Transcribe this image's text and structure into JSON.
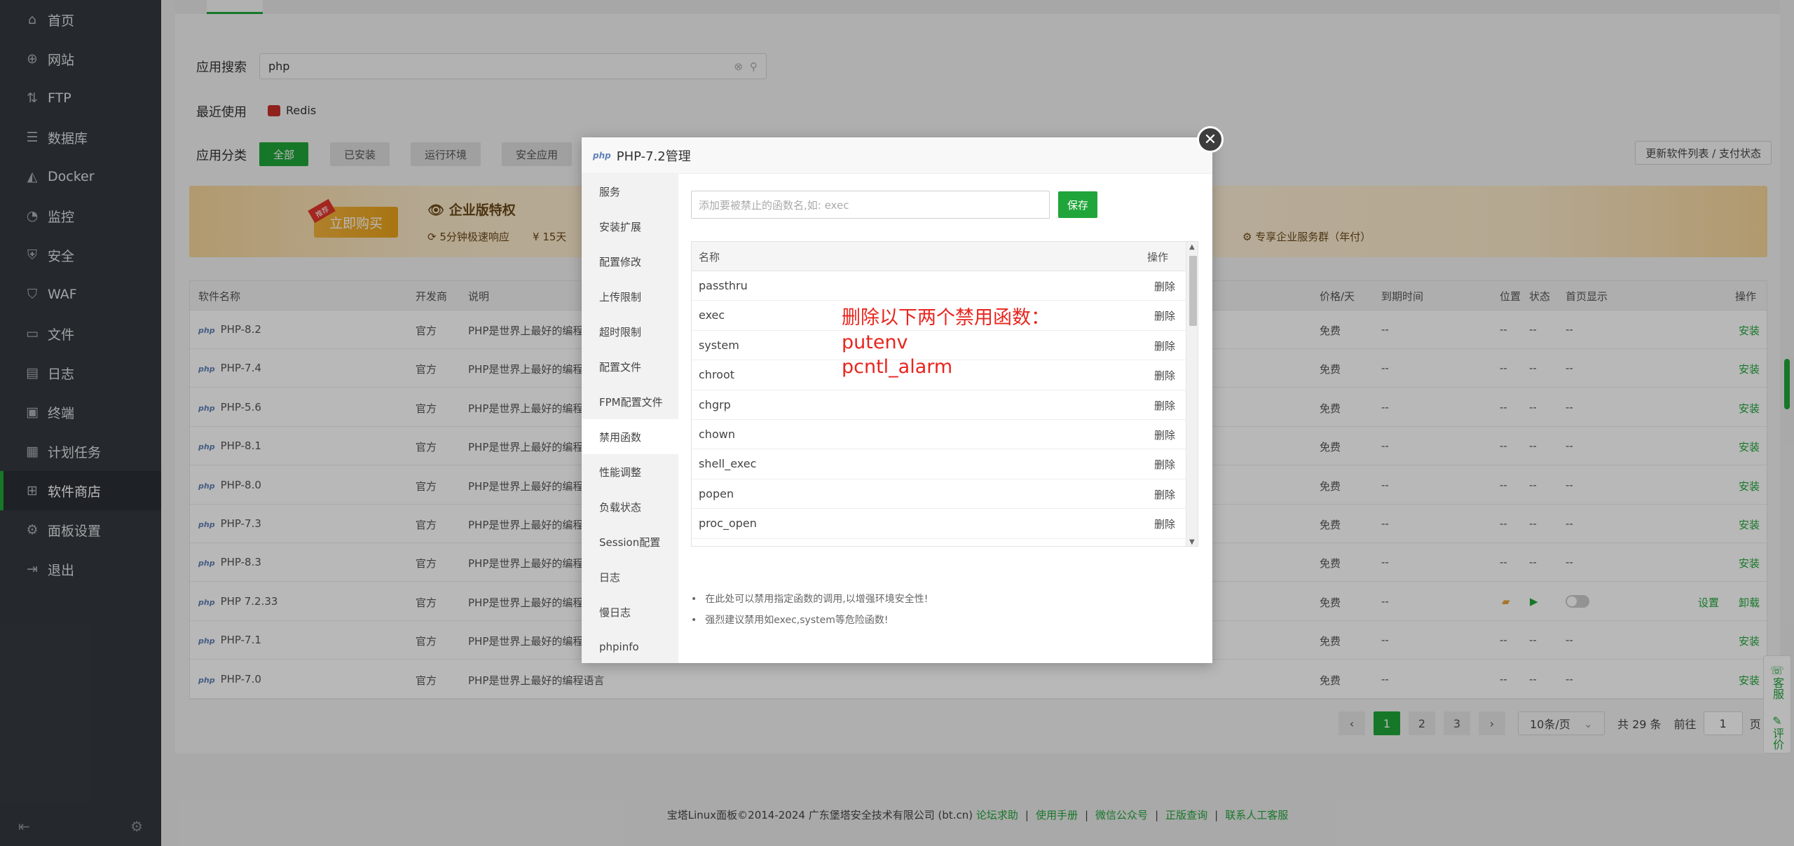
{
  "sidebar": {
    "items": [
      {
        "label": "首页",
        "icon": "home-icon"
      },
      {
        "label": "网站",
        "icon": "globe-icon"
      },
      {
        "label": "FTP",
        "icon": "ftp-icon"
      },
      {
        "label": "数据库",
        "icon": "database-icon"
      },
      {
        "label": "Docker",
        "icon": "docker-icon"
      },
      {
        "label": "监控",
        "icon": "monitor-icon"
      },
      {
        "label": "安全",
        "icon": "shield-icon"
      },
      {
        "label": "WAF",
        "icon": "waf-icon"
      },
      {
        "label": "文件",
        "icon": "folder-icon"
      },
      {
        "label": "日志",
        "icon": "log-icon"
      },
      {
        "label": "终端",
        "icon": "terminal-icon"
      },
      {
        "label": "计划任务",
        "icon": "calendar-icon"
      },
      {
        "label": "软件商店",
        "icon": "grid-icon"
      },
      {
        "label": "面板设置",
        "icon": "settings-icon"
      },
      {
        "label": "退出",
        "icon": "logout-icon"
      }
    ],
    "active_index": 12
  },
  "search": {
    "label": "应用搜索",
    "value": "php"
  },
  "recent": {
    "label": "最近使用",
    "item": "Redis"
  },
  "category": {
    "label": "应用分类",
    "buttons": [
      "全部",
      "已安装",
      "运行环境",
      "安全应用"
    ],
    "update_button": "更新软件列表 / 支付状态"
  },
  "banner": {
    "buy_button": "立即购买",
    "buy_tag": "推荐",
    "title": "企业版特权",
    "sub1": "5分钟极速响应",
    "sub2": "15天",
    "right_text": "专享企业服务群（年付）"
  },
  "table": {
    "headers": [
      "软件名称",
      "开发商",
      "说明",
      "价格/天",
      "到期时间",
      "位置",
      "状态",
      "首页显示",
      "操作"
    ],
    "rows": [
      {
        "name": "PHP-8.2",
        "dev": "官方",
        "desc": "PHP是世界上最好的编程语言",
        "price": "免费",
        "expire": "--",
        "loc": "--",
        "status": "--",
        "home": "--",
        "ops": "安装"
      },
      {
        "name": "PHP-7.4",
        "dev": "官方",
        "desc": "PHP是世界上最好的编程语言",
        "price": "免费",
        "expire": "--",
        "loc": "--",
        "status": "--",
        "home": "--",
        "ops": "安装"
      },
      {
        "name": "PHP-5.6",
        "dev": "官方",
        "desc": "PHP是世界上最好的编程语言",
        "price": "免费",
        "expire": "--",
        "loc": "--",
        "status": "--",
        "home": "--",
        "ops": "安装"
      },
      {
        "name": "PHP-8.1",
        "dev": "官方",
        "desc": "PHP是世界上最好的编程语言",
        "price": "免费",
        "expire": "--",
        "loc": "--",
        "status": "--",
        "home": "--",
        "ops": "安装"
      },
      {
        "name": "PHP-8.0",
        "dev": "官方",
        "desc": "PHP是世界上最好的编程语言",
        "price": "免费",
        "expire": "--",
        "loc": "--",
        "status": "--",
        "home": "--",
        "ops": "安装"
      },
      {
        "name": "PHP-7.3",
        "dev": "官方",
        "desc": "PHP是世界上最好的编程语言",
        "price": "免费",
        "expire": "--",
        "loc": "--",
        "status": "--",
        "home": "--",
        "ops": "安装"
      },
      {
        "name": "PHP-8.3",
        "dev": "官方",
        "desc": "PHP是世界上最好的编程语言",
        "price": "免费",
        "expire": "--",
        "loc": "--",
        "status": "--",
        "home": "--",
        "ops": "安装"
      },
      {
        "name": "PHP 7.2.33",
        "dev": "官方",
        "desc": "PHP是世界上最好的编程语言",
        "price": "免费",
        "expire": "--",
        "ops_set": "设置",
        "ops": "卸载"
      },
      {
        "name": "PHP-7.1",
        "dev": "官方",
        "desc": "PHP是世界上最好的编程语言",
        "price": "免费",
        "expire": "--",
        "loc": "--",
        "status": "--",
        "home": "--",
        "ops": "安装"
      },
      {
        "name": "PHP-7.0",
        "dev": "官方",
        "desc": "PHP是世界上最好的编程语言",
        "price": "免费",
        "expire": "--",
        "loc": "--",
        "status": "--",
        "home": "--",
        "ops": "安装"
      }
    ]
  },
  "pager": {
    "prev": "‹",
    "pages": [
      "1",
      "2",
      "3"
    ],
    "next": "›",
    "per_page": "10条/页",
    "total": "共 29 条",
    "goto_prefix": "前往",
    "goto_value": "1",
    "goto_suffix": "页"
  },
  "footer": {
    "copyright": "宝塔Linux面板©2014-2024 广东堡塔安全技术有限公司 (bt.cn)",
    "links": [
      "论坛求助",
      "使用手册",
      "微信公众号",
      "正版查询",
      "联系人工客服"
    ]
  },
  "float": {
    "service": "客服",
    "review": "评价"
  },
  "modal": {
    "logo": "php",
    "title": "PHP-7.2管理",
    "side": [
      "服务",
      "安装扩展",
      "配置修改",
      "上传限制",
      "超时限制",
      "配置文件",
      "FPM配置文件",
      "禁用函数",
      "性能调整",
      "负载状态",
      "Session配置",
      "日志",
      "慢日志",
      "phpinfo"
    ],
    "side_active": 7,
    "input_placeholder": "添加要被禁止的函数名,如: exec",
    "save": "保存",
    "col_name": "名称",
    "col_op": "操作",
    "functions": [
      "passthru",
      "exec",
      "system",
      "chroot",
      "chgrp",
      "chown",
      "shell_exec",
      "popen",
      "proc_open"
    ],
    "delete": "删除",
    "tips": [
      "在此处可以禁用指定函数的调用,以增强环境安全性!",
      "强烈建议禁用如exec,system等危险函数!"
    ]
  },
  "annotation": {
    "line1": "删除以下两个禁用函数：",
    "line2": "putenv",
    "line3": "pcntl_alarm"
  },
  "colors": {
    "accent": "#20a53a",
    "sidebar_bg": "#343a40",
    "annotation": "#e8251e"
  }
}
